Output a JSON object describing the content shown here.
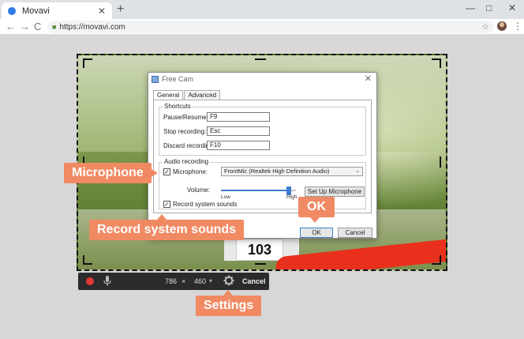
{
  "browser": {
    "tab_title": "Movavi",
    "tab_close": "✕",
    "new_tab": "+",
    "window_controls": [
      "—",
      "□",
      "✕"
    ],
    "nav": [
      "←",
      "→",
      "C"
    ],
    "url": "https://movavi.com",
    "star": "☆",
    "menu": "⋮",
    "icons": [
      "favicon",
      "lock-icon",
      "star-icon",
      "profile-avatar",
      "menu-icon"
    ]
  },
  "photo": {
    "bib_number": "103"
  },
  "dialog": {
    "title": "Free Cam",
    "close": "✕",
    "tabs": [
      "General",
      "Advanced"
    ],
    "shortcuts": {
      "title": "Shortcuts",
      "pause_label": "Pause/Resume:",
      "pause_value": "F9",
      "stop_label": "Stop recording:",
      "stop_value": "Esc",
      "discard_label": "Discard recording:",
      "discard_value": "F10"
    },
    "audio": {
      "title": "Audio recording",
      "microphone_label": "Microphone:",
      "microphone_checked": true,
      "microphone_value": "FrontMic (Realtek High Definition Audio)",
      "volume_label": "Volume:",
      "volume_low": "Low",
      "volume_high": "High",
      "volume_level": 0.9,
      "setup_button": "Set Up Microphone",
      "system_sounds_label": "Record system sounds",
      "system_sounds_checked": true,
      "check_mark": "✓"
    },
    "ok": "OK",
    "cancel": "Cancel"
  },
  "rec_toolbar": {
    "width": "786",
    "times": "×",
    "height": "460",
    "dropdown": "▾",
    "cancel": "Cancel"
  },
  "callouts": {
    "microphone": "Microphone",
    "system_sounds": "Record system sounds",
    "ok": "OK",
    "settings": "Settings"
  },
  "colors": {
    "callout": "#f08a63",
    "record": "#e53935",
    "accent": "#3d7cd1",
    "toolbar": "#2b2b2b"
  }
}
